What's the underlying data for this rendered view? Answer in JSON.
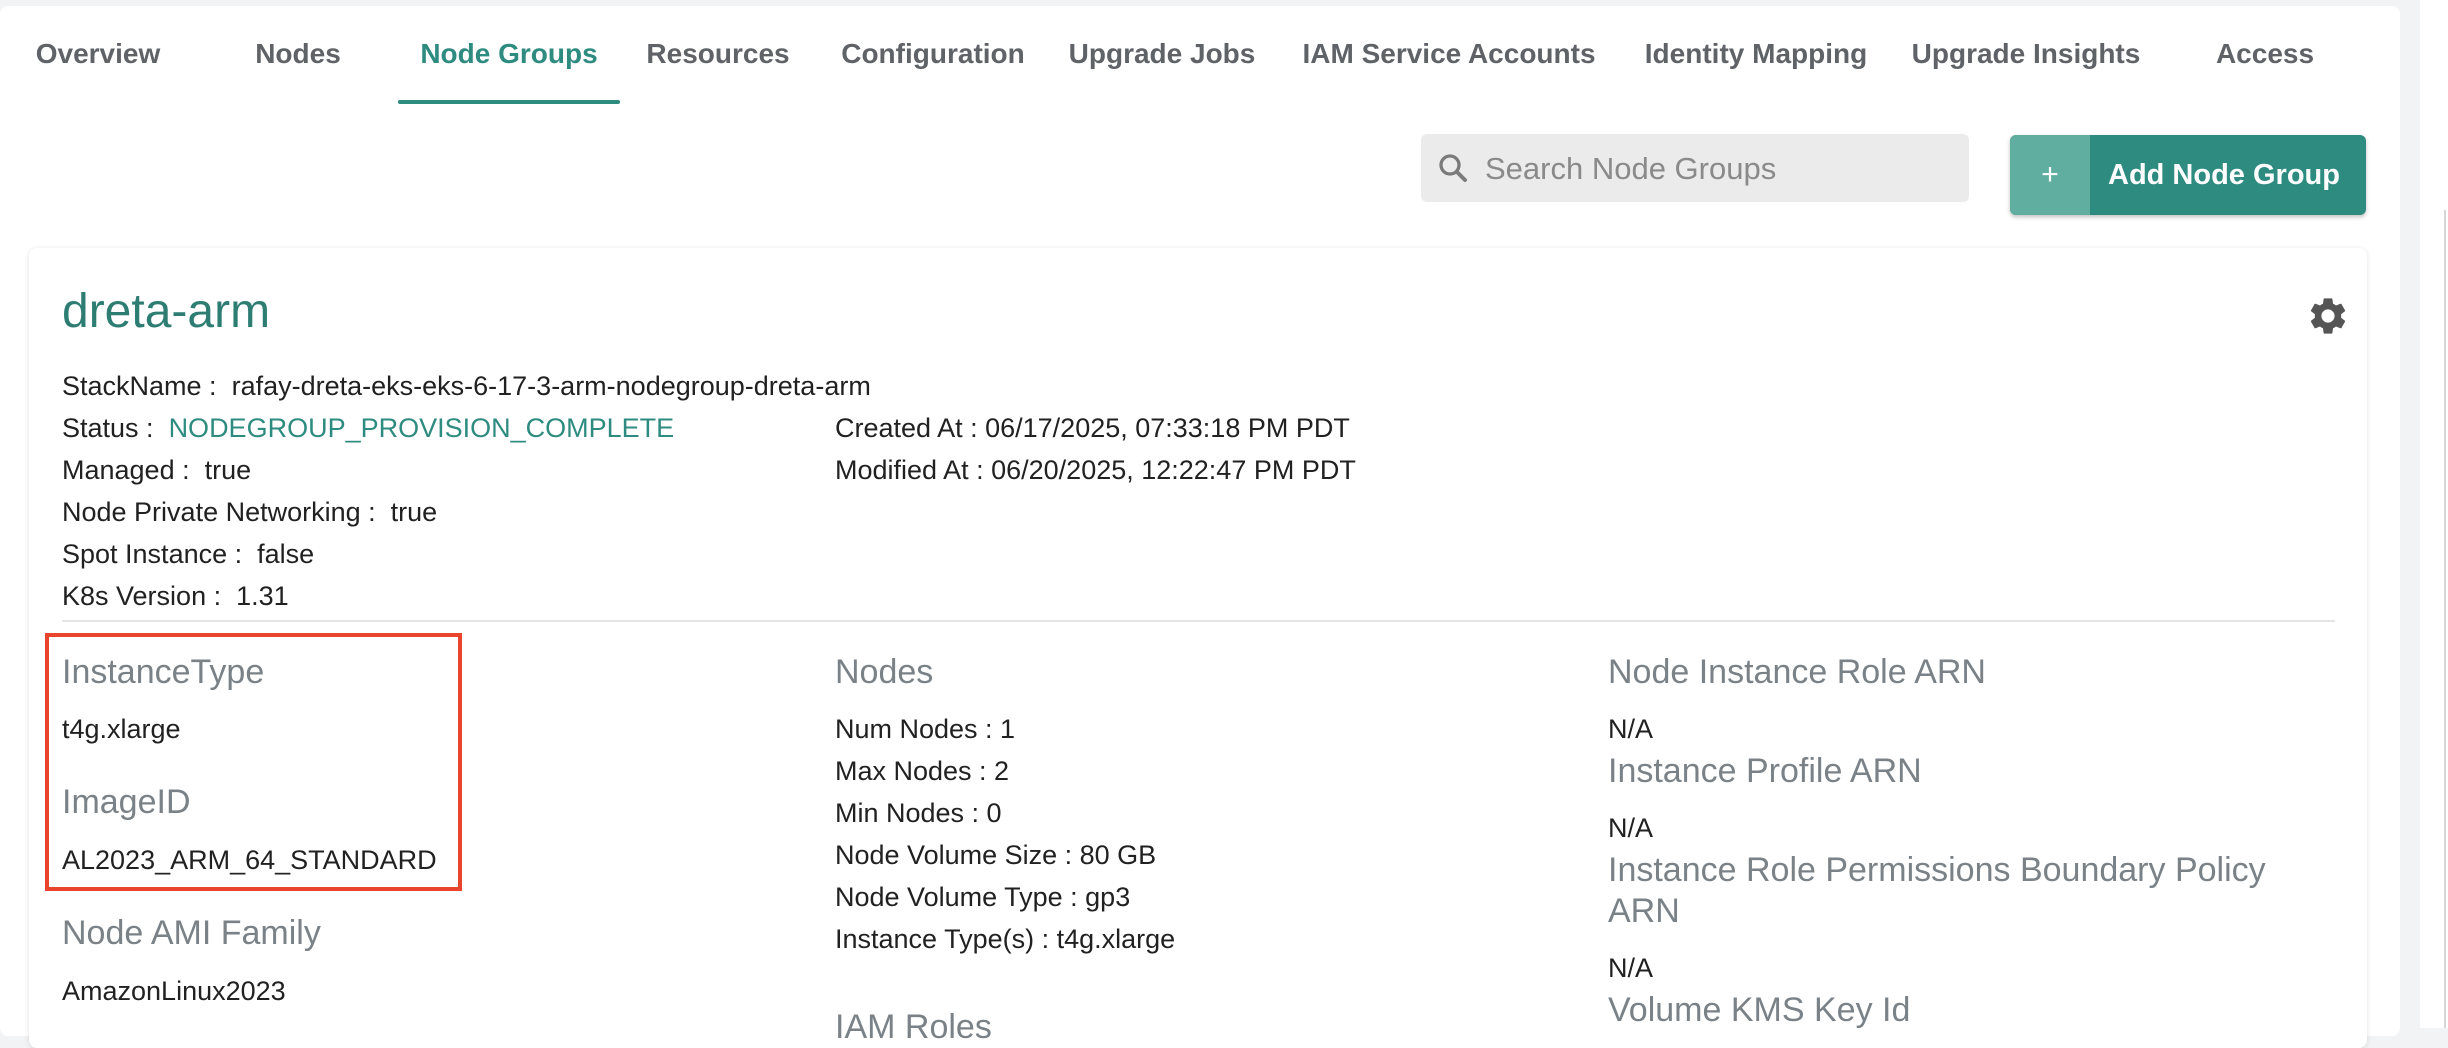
{
  "tabs": [
    {
      "label": "Overview",
      "active": false
    },
    {
      "label": "Nodes",
      "active": false
    },
    {
      "label": "Node Groups",
      "active": true
    },
    {
      "label": "Resources",
      "active": false
    },
    {
      "label": "Configuration",
      "active": false
    },
    {
      "label": "Upgrade Jobs",
      "active": false
    },
    {
      "label": "IAM Service Accounts",
      "active": false
    },
    {
      "label": "Identity Mapping",
      "active": false
    },
    {
      "label": "Upgrade Insights",
      "active": false
    },
    {
      "label": "Access",
      "active": false
    }
  ],
  "toolbar": {
    "search_placeholder": "Search Node Groups",
    "search_icon": "search-icon",
    "add_button_icon": "+",
    "add_button_label": "Add Node Group"
  },
  "nodegroup": {
    "name": "dreta-arm",
    "settings_icon": "gear-icon",
    "stack_name_label": "StackName :",
    "stack_name": "rafay-dreta-eks-eks-6-17-3-arm-nodegroup-dreta-arm",
    "status_label": "Status :",
    "status": "NODEGROUP_PROVISION_COMPLETE",
    "managed_label": "Managed :",
    "managed": "true",
    "private_networking_label": "Node Private Networking :",
    "private_networking": "true",
    "spot_label": "Spot Instance :",
    "spot": "false",
    "k8s_label": "K8s Version :",
    "k8s": "1.31",
    "created_label": "Created At :",
    "created": "06/17/2025, 07:33:18 PM PDT",
    "modified_label": "Modified At :",
    "modified": "06/20/2025, 12:22:47 PM PDT"
  },
  "details": {
    "instance_type_heading": "InstanceType",
    "instance_type": "t4g.xlarge",
    "image_id_heading": "ImageID",
    "image_id": "AL2023_ARM_64_STANDARD",
    "ami_family_heading": "Node AMI Family",
    "ami_family": "AmazonLinux2023",
    "nodes_heading": "Nodes",
    "num_nodes": "Num Nodes : 1",
    "max_nodes": "Max Nodes : 2",
    "min_nodes": "Min Nodes : 0",
    "volume_size": "Node Volume Size :  80 GB",
    "volume_type": "Node Volume Type :  gp3",
    "instance_types": "Instance Type(s) :  t4g.xlarge",
    "iam_roles_heading": "IAM Roles",
    "role_arn_heading": "Node Instance Role ARN",
    "role_arn": "N/A",
    "profile_arn_heading": "Instance Profile ARN",
    "profile_arn": "N/A",
    "boundary_heading_line1": "Instance Role Permissions Boundary Policy",
    "boundary_heading_line2": "ARN",
    "boundary": "N/A",
    "kms_heading": "Volume KMS Key Id"
  },
  "colors": {
    "accent": "#2e8b80",
    "highlight_box": "#e8452c"
  }
}
